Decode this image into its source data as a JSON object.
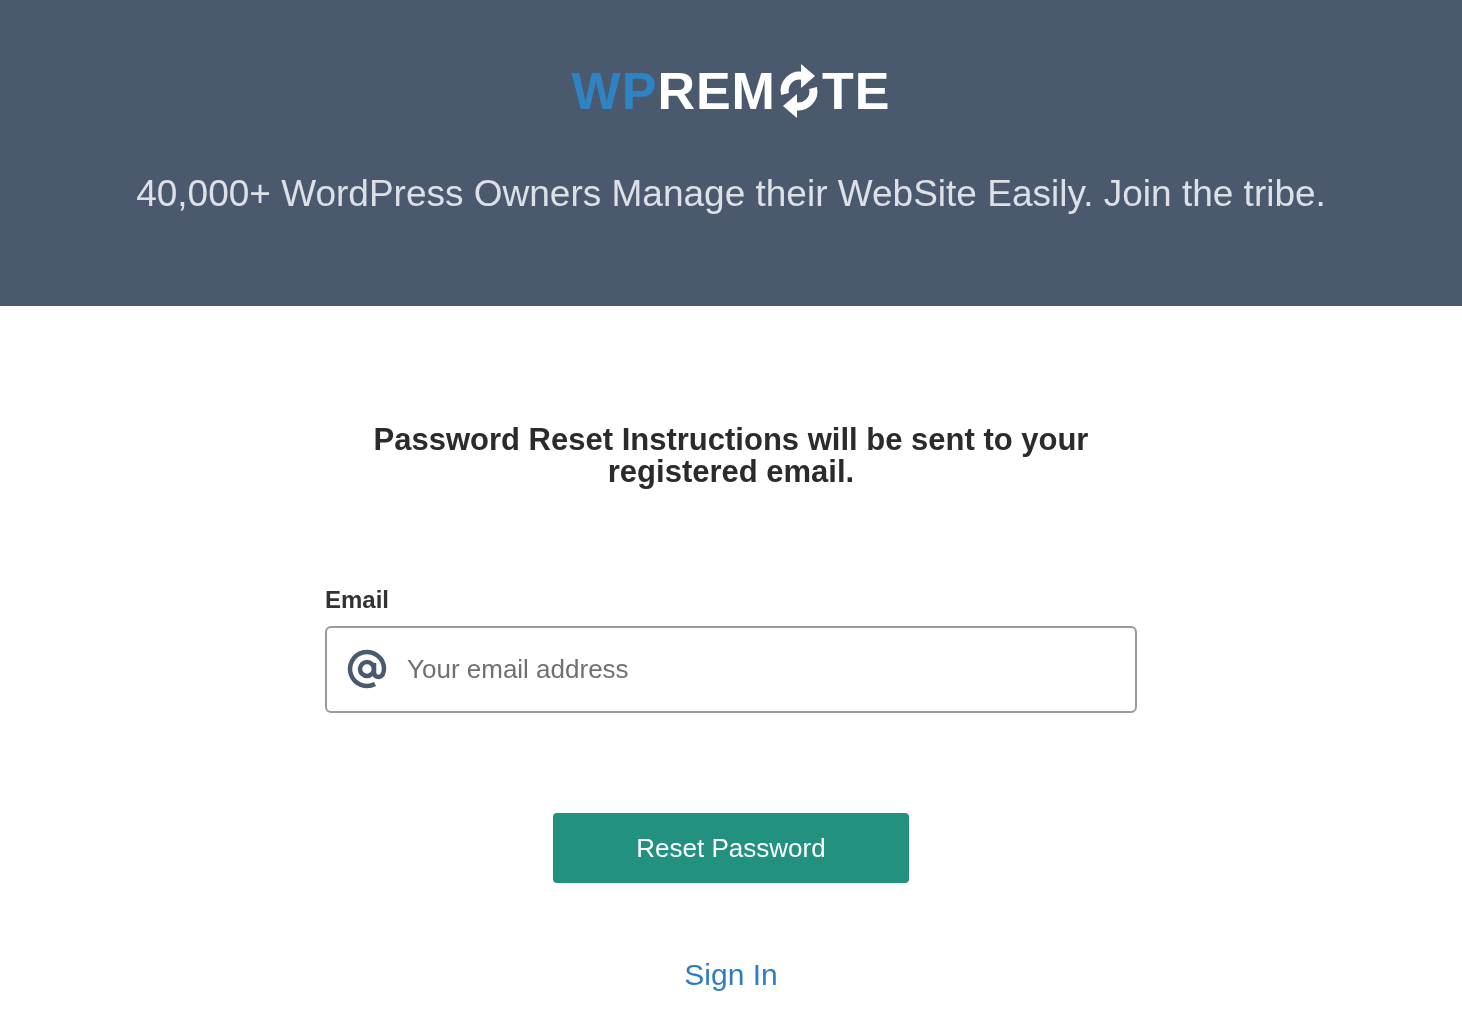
{
  "logo": {
    "prefix": "WP",
    "middle": "REM",
    "suffix": "TE"
  },
  "tagline": "40,000+ WordPress Owners Manage their WebSite Easily. Join the tribe.",
  "heading": "Password Reset Instructions will be sent to your registered email.",
  "email": {
    "label": "Email",
    "placeholder": "Your email address"
  },
  "button": "Reset Password",
  "link": "Sign In"
}
